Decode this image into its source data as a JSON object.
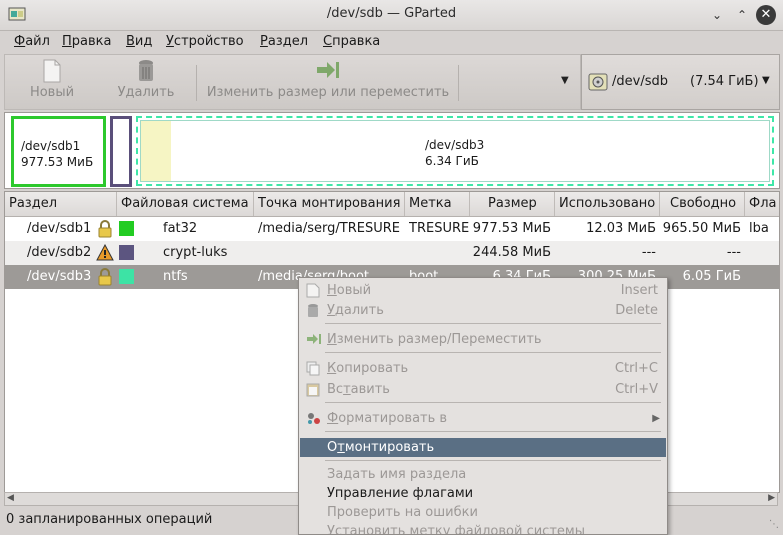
{
  "window": {
    "title": "/dev/sdb — GParted"
  },
  "menubar": [
    {
      "pre": "",
      "u": "Ф",
      "post": "айл"
    },
    {
      "pre": "",
      "u": "П",
      "post": "равка"
    },
    {
      "pre": "",
      "u": "В",
      "post": "ид"
    },
    {
      "pre": "",
      "u": "У",
      "post": "стройство"
    },
    {
      "pre": "",
      "u": "Р",
      "post": "аздел"
    },
    {
      "pre": "",
      "u": "С",
      "post": "правка"
    }
  ],
  "toolbar": {
    "new_label": "Новый",
    "delete_label": "Удалить",
    "resize_label": "Изменить размер или переместить"
  },
  "device": {
    "name": "/dev/sdb",
    "size": "(7.54 ГиБ)"
  },
  "graph": {
    "sdb1": {
      "name": "/dev/sdb1",
      "size": "977.53 МиБ"
    },
    "sdb3": {
      "name": "/dev/sdb3",
      "size": "6.34 ГиБ"
    }
  },
  "table": {
    "headers": [
      "Раздел",
      "Файловая система",
      "Точка монтирования",
      "Метка",
      "Размер",
      "Использовано",
      "Свободно",
      "Фла"
    ],
    "rows": [
      {
        "partition": "/dev/sdb1",
        "fs": "fat32",
        "mount": "/media/serg/TRESURE",
        "label": "TRESURE",
        "size": "977.53 МиБ",
        "used": "12.03 МиБ",
        "free": "965.50 МиБ",
        "flags": "lba",
        "color": "#22cc22"
      },
      {
        "partition": "/dev/sdb2",
        "fs": "crypt-luks",
        "mount": "",
        "label": "",
        "size": "244.58 МиБ",
        "used": "---",
        "free": "---",
        "flags": "",
        "color": "#5c5580"
      },
      {
        "partition": "/dev/sdb3",
        "fs": "ntfs",
        "mount": "/media/serg/boot",
        "label": "boot",
        "size": "6.34 ГиБ",
        "used": "300.25 МиБ",
        "free": "6.05 ГиБ",
        "flags": "",
        "color": "#3de3a5"
      }
    ]
  },
  "status": {
    "text": "0 запланированных операций"
  },
  "context_menu": {
    "new": {
      "u": "Н",
      "post": "овый",
      "acc": "Insert"
    },
    "delete": {
      "u": "У",
      "post": "далить",
      "acc": "Delete"
    },
    "resize": {
      "u": "И",
      "post": "зменить размер/Переместить"
    },
    "copy": {
      "u": "К",
      "post": "опировать",
      "acc": "Ctrl+C"
    },
    "paste": {
      "pre": "Вс",
      "u": "т",
      "post": "авить",
      "acc": "Ctrl+V"
    },
    "format": {
      "u": "Ф",
      "post": "орматировать в"
    },
    "unmount": {
      "pre": "О",
      "u": "т",
      "post": "монтировать"
    },
    "name": {
      "label": "Задать имя раздела"
    },
    "flags": {
      "label": "Управление флагами"
    },
    "check": {
      "label": "Проверить на ошибки"
    },
    "fs_label": {
      "label": "Установить метку файловой системы"
    }
  }
}
